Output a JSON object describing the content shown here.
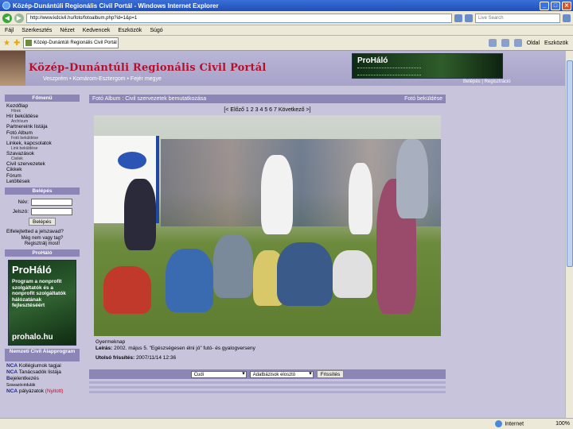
{
  "window": {
    "title": "Közép-Dunántúli Regionális Civil Portál - Windows Internet Explorer"
  },
  "address": {
    "url": "http://www.kdcivil.hu/foto/fotoalbum.php?id=1&p=1",
    "search_placeholder": "Live Search"
  },
  "menubar": {
    "items": [
      "Fájl",
      "Szerkesztés",
      "Nézet",
      "Kedvencek",
      "Eszközök",
      "Súgó"
    ]
  },
  "tabs": {
    "active_label": "Közép-Dunántúli Regionális Civil Portál",
    "tools": [
      "Oldal",
      "Eszközök"
    ]
  },
  "banner": {
    "title": "Közép-Dunántúli Regionális Civil Portál",
    "subtitle": "Veszprém • Komárom-Esztergom • Fejér megye",
    "prohalo_title": "ProHáló",
    "login_text": "Belépés | Regisztráció",
    "register_text": "Regisztráció"
  },
  "sidebar": {
    "menu_head": "Főmenü",
    "menu": [
      {
        "label": "Kezdőlap",
        "small": false
      },
      {
        "label": "Hírek",
        "small": true
      },
      {
        "label": "Hír beküldése",
        "small": false
      },
      {
        "label": "Archívum",
        "small": true
      },
      {
        "label": "Partnereink listája",
        "small": false
      },
      {
        "label": "Fotó Album",
        "small": false
      },
      {
        "label": "Fotó beküldése",
        "small": true
      },
      {
        "label": "Linkek, kapcsolatok",
        "small": false
      },
      {
        "label": "Link beküldése",
        "small": true
      },
      {
        "label": "Szavazások",
        "small": false
      },
      {
        "label": "Civilek",
        "small": true
      },
      {
        "label": "Civil szervezetek",
        "small": false
      },
      {
        "label": "Cikkek",
        "small": false
      },
      {
        "label": "Fórum",
        "small": false
      },
      {
        "label": "Letöltések",
        "small": false
      }
    ],
    "login_head": "Belépés",
    "name_label": "Név:",
    "password_label": "Jelszó:",
    "login_button": "Belépés",
    "forgot": "Elfelejtetted a jelszavad?",
    "links_line1": "Még nem vagy tag?",
    "links_line2": "Regisztrálj most!",
    "prohalo_head": "ProHáló",
    "ad_title": "ProHáló",
    "ad_text": "Program a nonprofit szolgáltatók és a nonprofit szolgáltatók hálózatának fejlesztéséért",
    "ad_url": "prohalo.hu",
    "nca_head": "Nemzeti Civil Alapprogram",
    "nca_items": [
      {
        "prefix": "NCA",
        "text": "Kollégiumok tagjai"
      },
      {
        "prefix": "NCA",
        "text": "Tanácsadók listája"
      },
      {
        "prefix": "B",
        "text": "ejelentkezés"
      },
      {
        "prefix": "",
        "text": "Szavazócédulák"
      },
      {
        "prefix": "NCA",
        "text": "pályázatok",
        "extra": "(Nyitott)"
      }
    ]
  },
  "main": {
    "header_left": "Fotó Album : Civil szervezetek bemutatkozása",
    "header_right": "Fotó beküldése",
    "pager": {
      "prev": "[< Előző",
      "pages": [
        "1",
        "2",
        "3",
        "4",
        "5",
        "6",
        "7"
      ],
      "next": "Következő >]"
    },
    "info": {
      "title": "Gyermeknap",
      "desc_label": "Leírás:",
      "desc": "2002. május 5. \"Egészségesen élni jó\" futó- és gyalogverseny",
      "updated_label": "Utolsó frissítés:",
      "updated": "2007/11/14 12:36"
    },
    "form": {
      "select1": "Cudi",
      "select2": "Adatbázisok elosztó",
      "button": "Frissítés"
    }
  },
  "status": {
    "zone": "Internet",
    "zoom": "100%"
  }
}
